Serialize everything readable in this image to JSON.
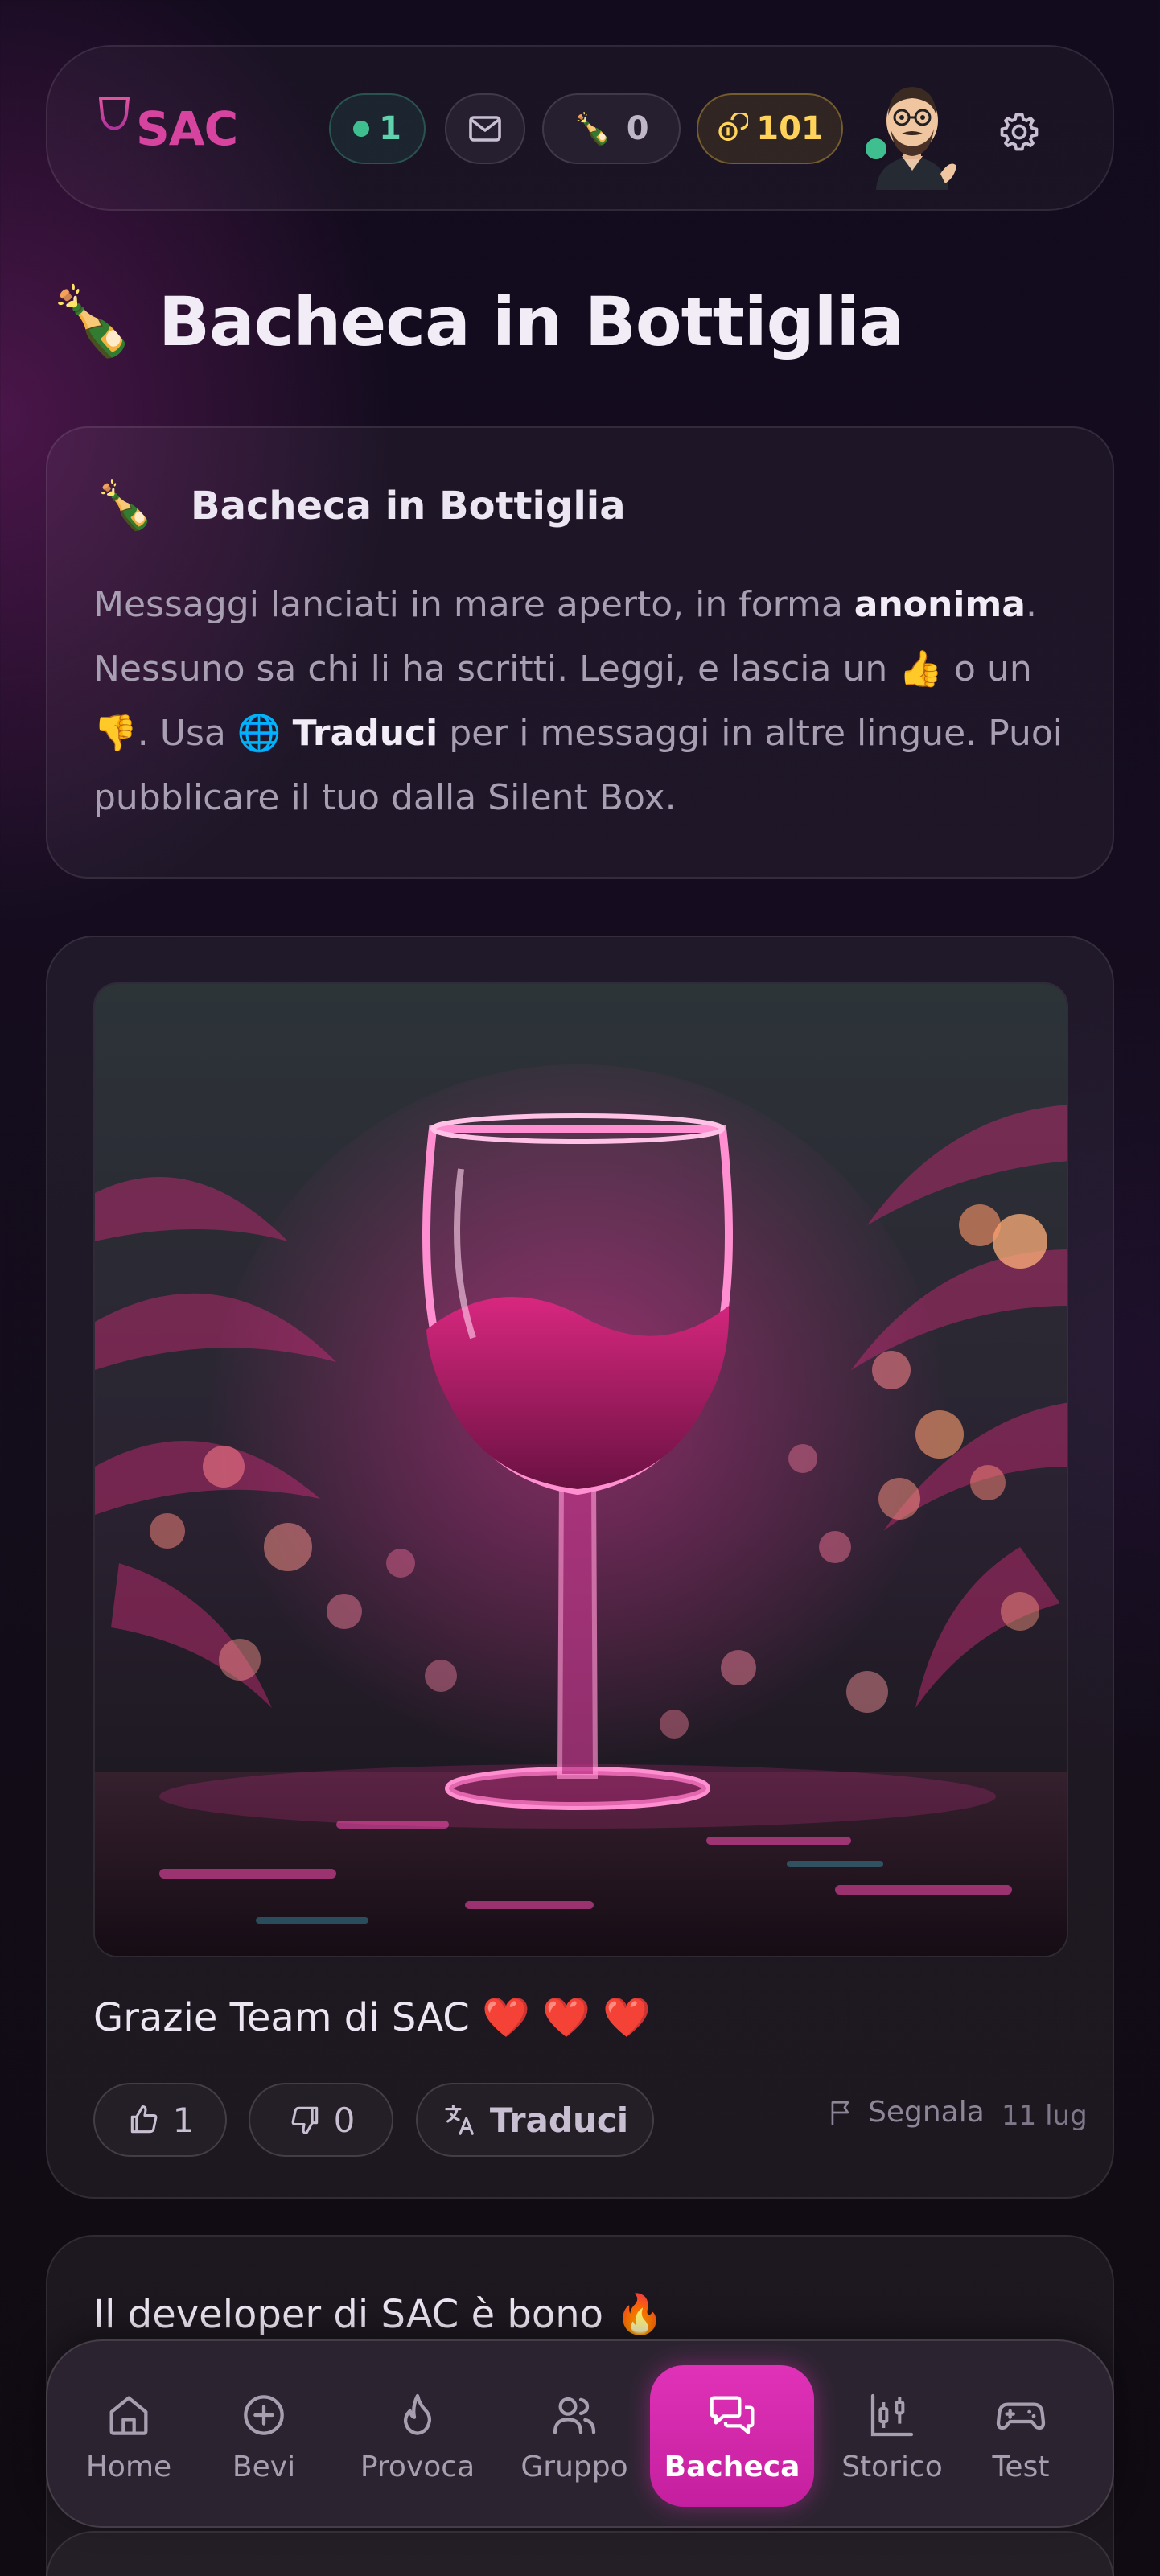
{
  "header": {
    "logo_text": "SAC",
    "online_count": "1",
    "bottle_count": "0",
    "coins": "101"
  },
  "page": {
    "title": "Bacheca in Bottiglia",
    "title_emoji": "🍾"
  },
  "info": {
    "emoji": "🍾",
    "title": "Bacheca in Bottiglia",
    "text_1": "Messaggi lanciati in mare aperto, in forma ",
    "bold_1": "anonima",
    "text_2": ". Nessuno sa chi li ha scritti. Leggi, e lascia un ",
    "emoji_up": "👍",
    "text_3": " o un ",
    "emoji_down": "👎",
    "text_4": ". Usa ",
    "emoji_globe": "🌐",
    "bold_2": "Traduci",
    "text_5": " per i messaggi in altre lingue. Puoi pubblicare il tuo dalla Silent Box."
  },
  "posts": [
    {
      "text": "Grazie Team di SAC ❤️ ❤️ ❤️",
      "likes": "1",
      "dislikes": "0",
      "translate_label": "Traduci",
      "report_label": "Segnala",
      "date": "11 lug"
    },
    {
      "text": "Il developer di SAC è bono 🔥"
    }
  ],
  "nav": {
    "items": [
      {
        "label": "Home",
        "icon": "home-icon"
      },
      {
        "label": "Bevi",
        "icon": "plus-circle-icon"
      },
      {
        "label": "Provoca",
        "icon": "flame-icon"
      },
      {
        "label": "Gruppo",
        "icon": "users-icon"
      },
      {
        "label": "Bacheca",
        "icon": "messages-icon",
        "active": true
      },
      {
        "label": "Storico",
        "icon": "candlestick-chart-icon"
      },
      {
        "label": "Test",
        "icon": "gamepad-icon"
      }
    ]
  },
  "colors": {
    "accent": "#d7449f",
    "active_nav": "#d62aae",
    "online": "#3fbf8f",
    "coins": "#ffd35a"
  }
}
